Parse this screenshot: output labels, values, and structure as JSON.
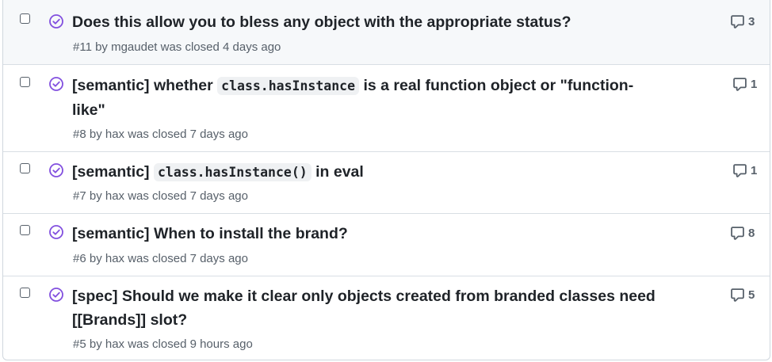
{
  "issues": [
    {
      "title_parts": [
        "Does this allow you to bless any object with the appropriate status?"
      ],
      "meta": "#11 by mgaudet was closed 4 days ago",
      "comments": "3"
    },
    {
      "title_parts": [
        "[semantic] whether ",
        "class.hasInstance",
        " is a real function object or \"function-like\""
      ],
      "meta": "#8 by hax was closed 7 days ago",
      "comments": "1"
    },
    {
      "title_parts": [
        "[semantic] ",
        "class.hasInstance()",
        " in eval"
      ],
      "meta": "#7 by hax was closed 7 days ago",
      "comments": "1"
    },
    {
      "title_parts": [
        "[semantic] When to install the brand?"
      ],
      "meta": "#6 by hax was closed 7 days ago",
      "comments": "8"
    },
    {
      "title_parts": [
        "[spec] Should we make it clear only objects created from branded classes need [[Brands]] slot?"
      ],
      "meta": "#5 by hax was closed 9 hours ago",
      "comments": "5"
    }
  ],
  "icons": {
    "state": "issue-closed-check-icon",
    "comment": "comment-icon"
  },
  "colors": {
    "closed_purple": "#8250df",
    "text": "#1f2328",
    "muted": "#57606a",
    "hover_bg": "#f6f8fa"
  }
}
